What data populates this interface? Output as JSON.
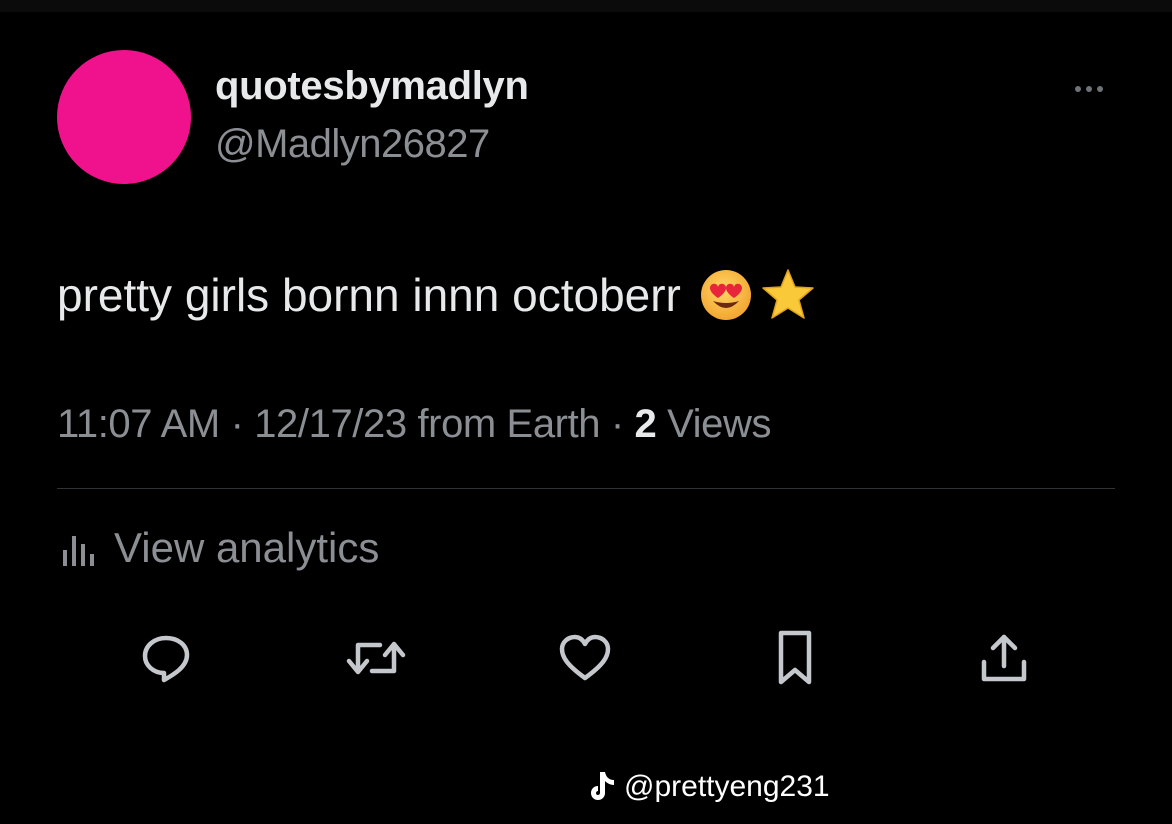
{
  "tweet": {
    "display_name": "quotesbymadlyn",
    "handle": "@Madlyn26827",
    "avatar_color": "#f0128c",
    "text": "pretty girls bornn innn octoberr",
    "emojis": [
      "heart-eyes-emoji",
      "star-emoji"
    ],
    "timestamp": "11:07 AM",
    "date": "12/17/23",
    "source": "from Earth",
    "separator": "·",
    "views_count": "2",
    "views_label": "Views"
  },
  "analytics": {
    "label": "View analytics",
    "icon": "analytics-bar-icon"
  },
  "actions": [
    {
      "name": "reply",
      "icon": "speech-bubble-icon"
    },
    {
      "name": "retweet",
      "icon": "retweet-arrows-icon"
    },
    {
      "name": "like",
      "icon": "heart-icon"
    },
    {
      "name": "bookmark",
      "icon": "bookmark-icon"
    },
    {
      "name": "share",
      "icon": "share-upload-icon"
    }
  ],
  "more_menu_icon": "more-dots-icon",
  "watermark": {
    "text": "@prettyeng231",
    "icon": "tiktok-logo"
  },
  "colors": {
    "background": "#000000",
    "primary_text": "#e7e9ea",
    "secondary_text": "#8b8f94",
    "icon": "#c4c8cc",
    "divider": "#2f3336"
  }
}
